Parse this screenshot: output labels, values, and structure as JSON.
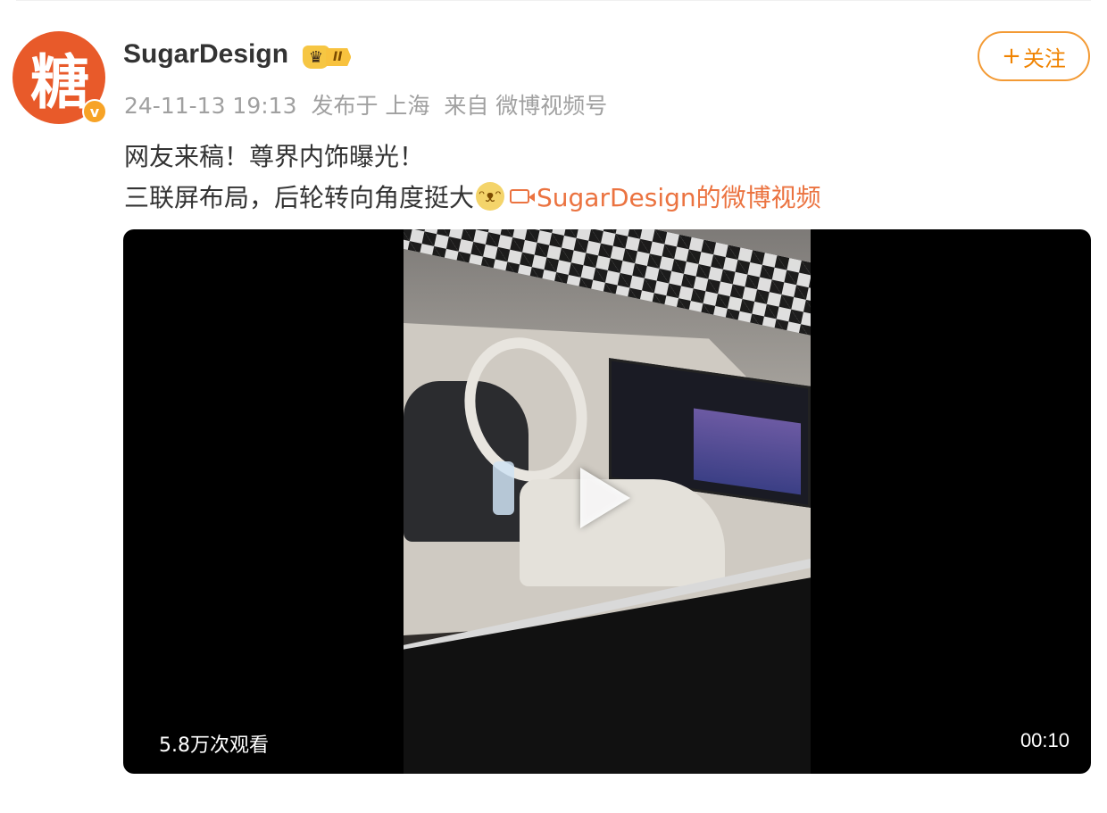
{
  "user": {
    "name": "SugarDesign",
    "avatar_glyph": "糖",
    "verified_mark": "v",
    "level": "II"
  },
  "post": {
    "timestamp": "24-11-13 19:13",
    "published_at": "发布于 上海",
    "source": "来自 微博视频号",
    "line1": "网友来稿！尊界内饰曝光！",
    "line2": "三联屏布局，后轮转向角度挺大",
    "video_link_label": "SugarDesign的微博视频"
  },
  "follow": {
    "plus": "+",
    "label": "关注"
  },
  "video": {
    "views": "5.8万次观看",
    "duration": "00:10"
  },
  "colors": {
    "accent": "#f08300",
    "link": "#eb7340",
    "avatar_bg": "#e85a2a"
  }
}
